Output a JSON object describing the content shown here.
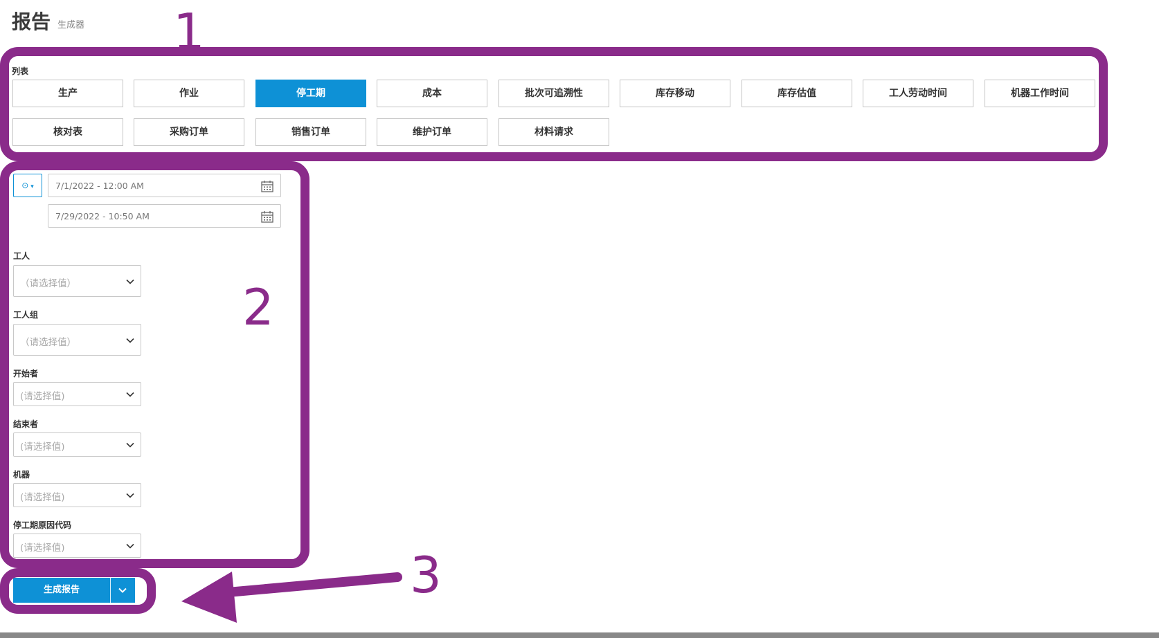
{
  "header": {
    "title": "报告",
    "subtitle": "生成器"
  },
  "list": {
    "label": "列表",
    "buttons": [
      {
        "label": "生产",
        "active": false
      },
      {
        "label": "作业",
        "active": false
      },
      {
        "label": "停工期",
        "active": true
      },
      {
        "label": "成本",
        "active": false
      },
      {
        "label": "批次可追溯性",
        "active": false
      },
      {
        "label": "库存移动",
        "active": false
      },
      {
        "label": "库存估值",
        "active": false
      },
      {
        "label": "工人劳动时间",
        "active": false
      },
      {
        "label": "机器工作时间",
        "active": false
      },
      {
        "label": "核对表",
        "active": false
      },
      {
        "label": "采购订单",
        "active": false
      },
      {
        "label": "销售订单",
        "active": false
      },
      {
        "label": "维护订单",
        "active": false
      },
      {
        "label": "材料请求",
        "active": false
      }
    ]
  },
  "filters": {
    "date_from": "7/1/2022 - 12:00 AM",
    "date_to": "7/29/2022 - 10:50 AM",
    "worker": {
      "label": "工人",
      "placeholder": "（请选择值）"
    },
    "worker_group": {
      "label": "工人组",
      "placeholder": "（请选择值）"
    },
    "started_by": {
      "label": "开始者",
      "placeholder": "(请选择值)"
    },
    "ended_by": {
      "label": "结束者",
      "placeholder": "(请选择值)"
    },
    "machine": {
      "label": "机器",
      "placeholder": "(请选择值)"
    },
    "downtime_reason": {
      "label": "停工期原因代码",
      "placeholder": "(请选择值)"
    }
  },
  "actions": {
    "generate_label": "生成报告"
  },
  "annotations": {
    "n1": "1",
    "n2": "2",
    "n3": "3"
  },
  "colors": {
    "accent": "#0e91d6",
    "annotation": "#8a2b8a"
  },
  "icons": [
    "clock-icon",
    "calendar-icon",
    "chevron-down-icon"
  ]
}
